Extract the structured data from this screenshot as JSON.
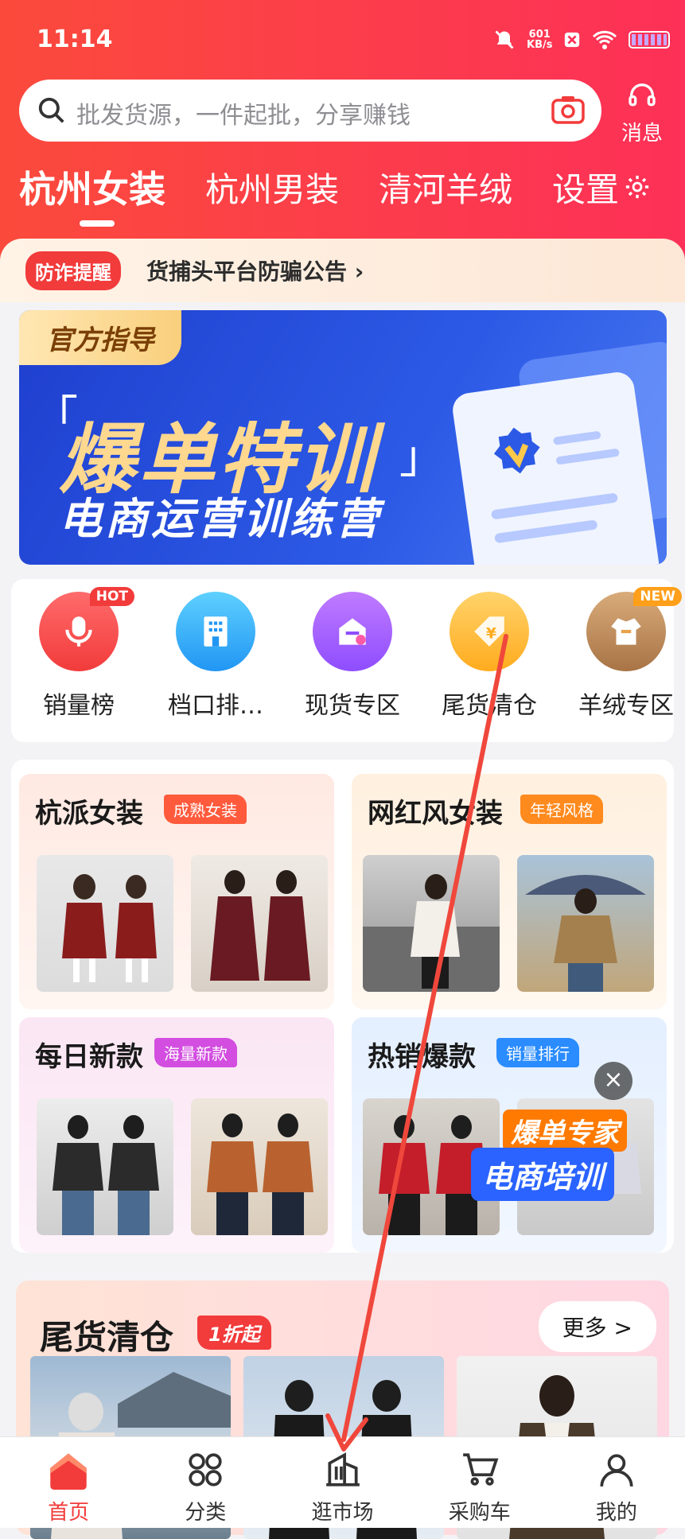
{
  "status": {
    "time": "11:14",
    "speed_value": "601",
    "speed_unit": "KB/s"
  },
  "search": {
    "placeholder": "批发货源，一件起批，分享赚钱"
  },
  "messages": {
    "label": "消息"
  },
  "tabs": [
    "杭州女装",
    "杭州男装",
    "清河羊绒",
    "设置"
  ],
  "notice": {
    "tag": "防诈提醒",
    "text": "货捕头平台防骗公告 ›"
  },
  "banner": {
    "tag": "官方指导",
    "title": "爆单特训",
    "subtitle": "电商运营训练营",
    "quote_open": "「",
    "quote_close": "」"
  },
  "shortcuts": [
    {
      "label": "销量榜",
      "badge": "HOT"
    },
    {
      "label": "档口排…",
      "badge": ""
    },
    {
      "label": "现货专区",
      "badge": ""
    },
    {
      "label": "尾货清仓",
      "badge": ""
    },
    {
      "label": "羊绒专区",
      "badge": "NEW"
    }
  ],
  "categories": [
    {
      "title": "杭派女装",
      "tag": "成熟女装"
    },
    {
      "title": "网红风女装",
      "tag": "年轻风格"
    },
    {
      "title": "每日新款",
      "tag": "海量新款"
    },
    {
      "title": "热销爆款",
      "tag": "销量排行"
    }
  ],
  "promo": {
    "line1": "爆单专家",
    "line2": "电商培训",
    "close": "×"
  },
  "clearance": {
    "title": "尾货清仓",
    "tag": "1折起",
    "more": "更多 >"
  },
  "tabbar": [
    {
      "label": "首页",
      "active": true
    },
    {
      "label": "分类",
      "active": false
    },
    {
      "label": "逛市场",
      "active": false
    },
    {
      "label": "采购车",
      "active": false
    },
    {
      "label": "我的",
      "active": false
    }
  ],
  "colors": {
    "brand_red": "#f23b3b",
    "banner_blue": "#2c5ae6"
  }
}
